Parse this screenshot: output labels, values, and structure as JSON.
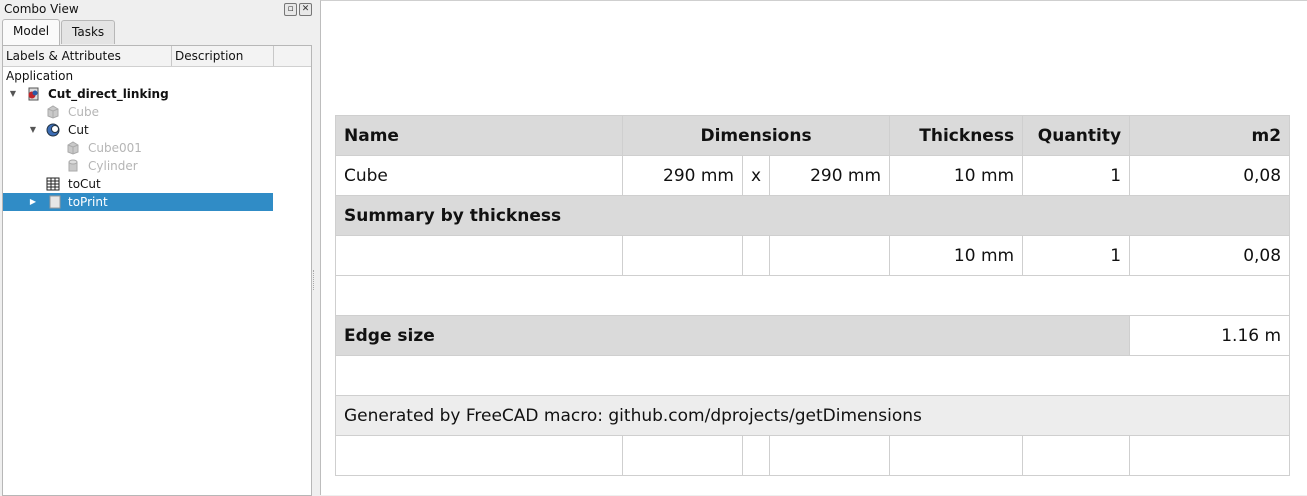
{
  "dock": {
    "title": "Combo View",
    "tabs": [
      "Model",
      "Tasks"
    ],
    "columns": [
      "Labels & Attributes",
      "Description"
    ],
    "root_label": "Application",
    "tree": [
      {
        "label": "Cut_direct_linking",
        "icon": "document-icon"
      },
      {
        "label": "Cube",
        "icon": "cube-icon"
      },
      {
        "label": "Cut",
        "icon": "cut-icon"
      },
      {
        "label": "Cube001",
        "icon": "cube-icon"
      },
      {
        "label": "Cylinder",
        "icon": "cylinder-icon"
      },
      {
        "label": "toCut",
        "icon": "spreadsheet-icon"
      },
      {
        "label": "toPrint",
        "icon": "page-icon"
      }
    ]
  },
  "sheet": {
    "headers": {
      "name": "Name",
      "dimensions": "Dimensions",
      "thickness": "Thickness",
      "quantity": "Quantity",
      "m2": "m2"
    },
    "item": {
      "name": "Cube",
      "dim1": "290 mm",
      "sep": "x",
      "dim2": "290 mm",
      "thickness": "10 mm",
      "quantity": "1",
      "m2": "0,08"
    },
    "summary_title": "Summary by thickness",
    "summary": {
      "thickness": "10 mm",
      "quantity": "1",
      "m2": "0,08"
    },
    "edge_label": "Edge size",
    "edge_value": "1.16 m",
    "footer": "Generated by FreeCAD macro: github.com/dprojects/getDimensions"
  }
}
